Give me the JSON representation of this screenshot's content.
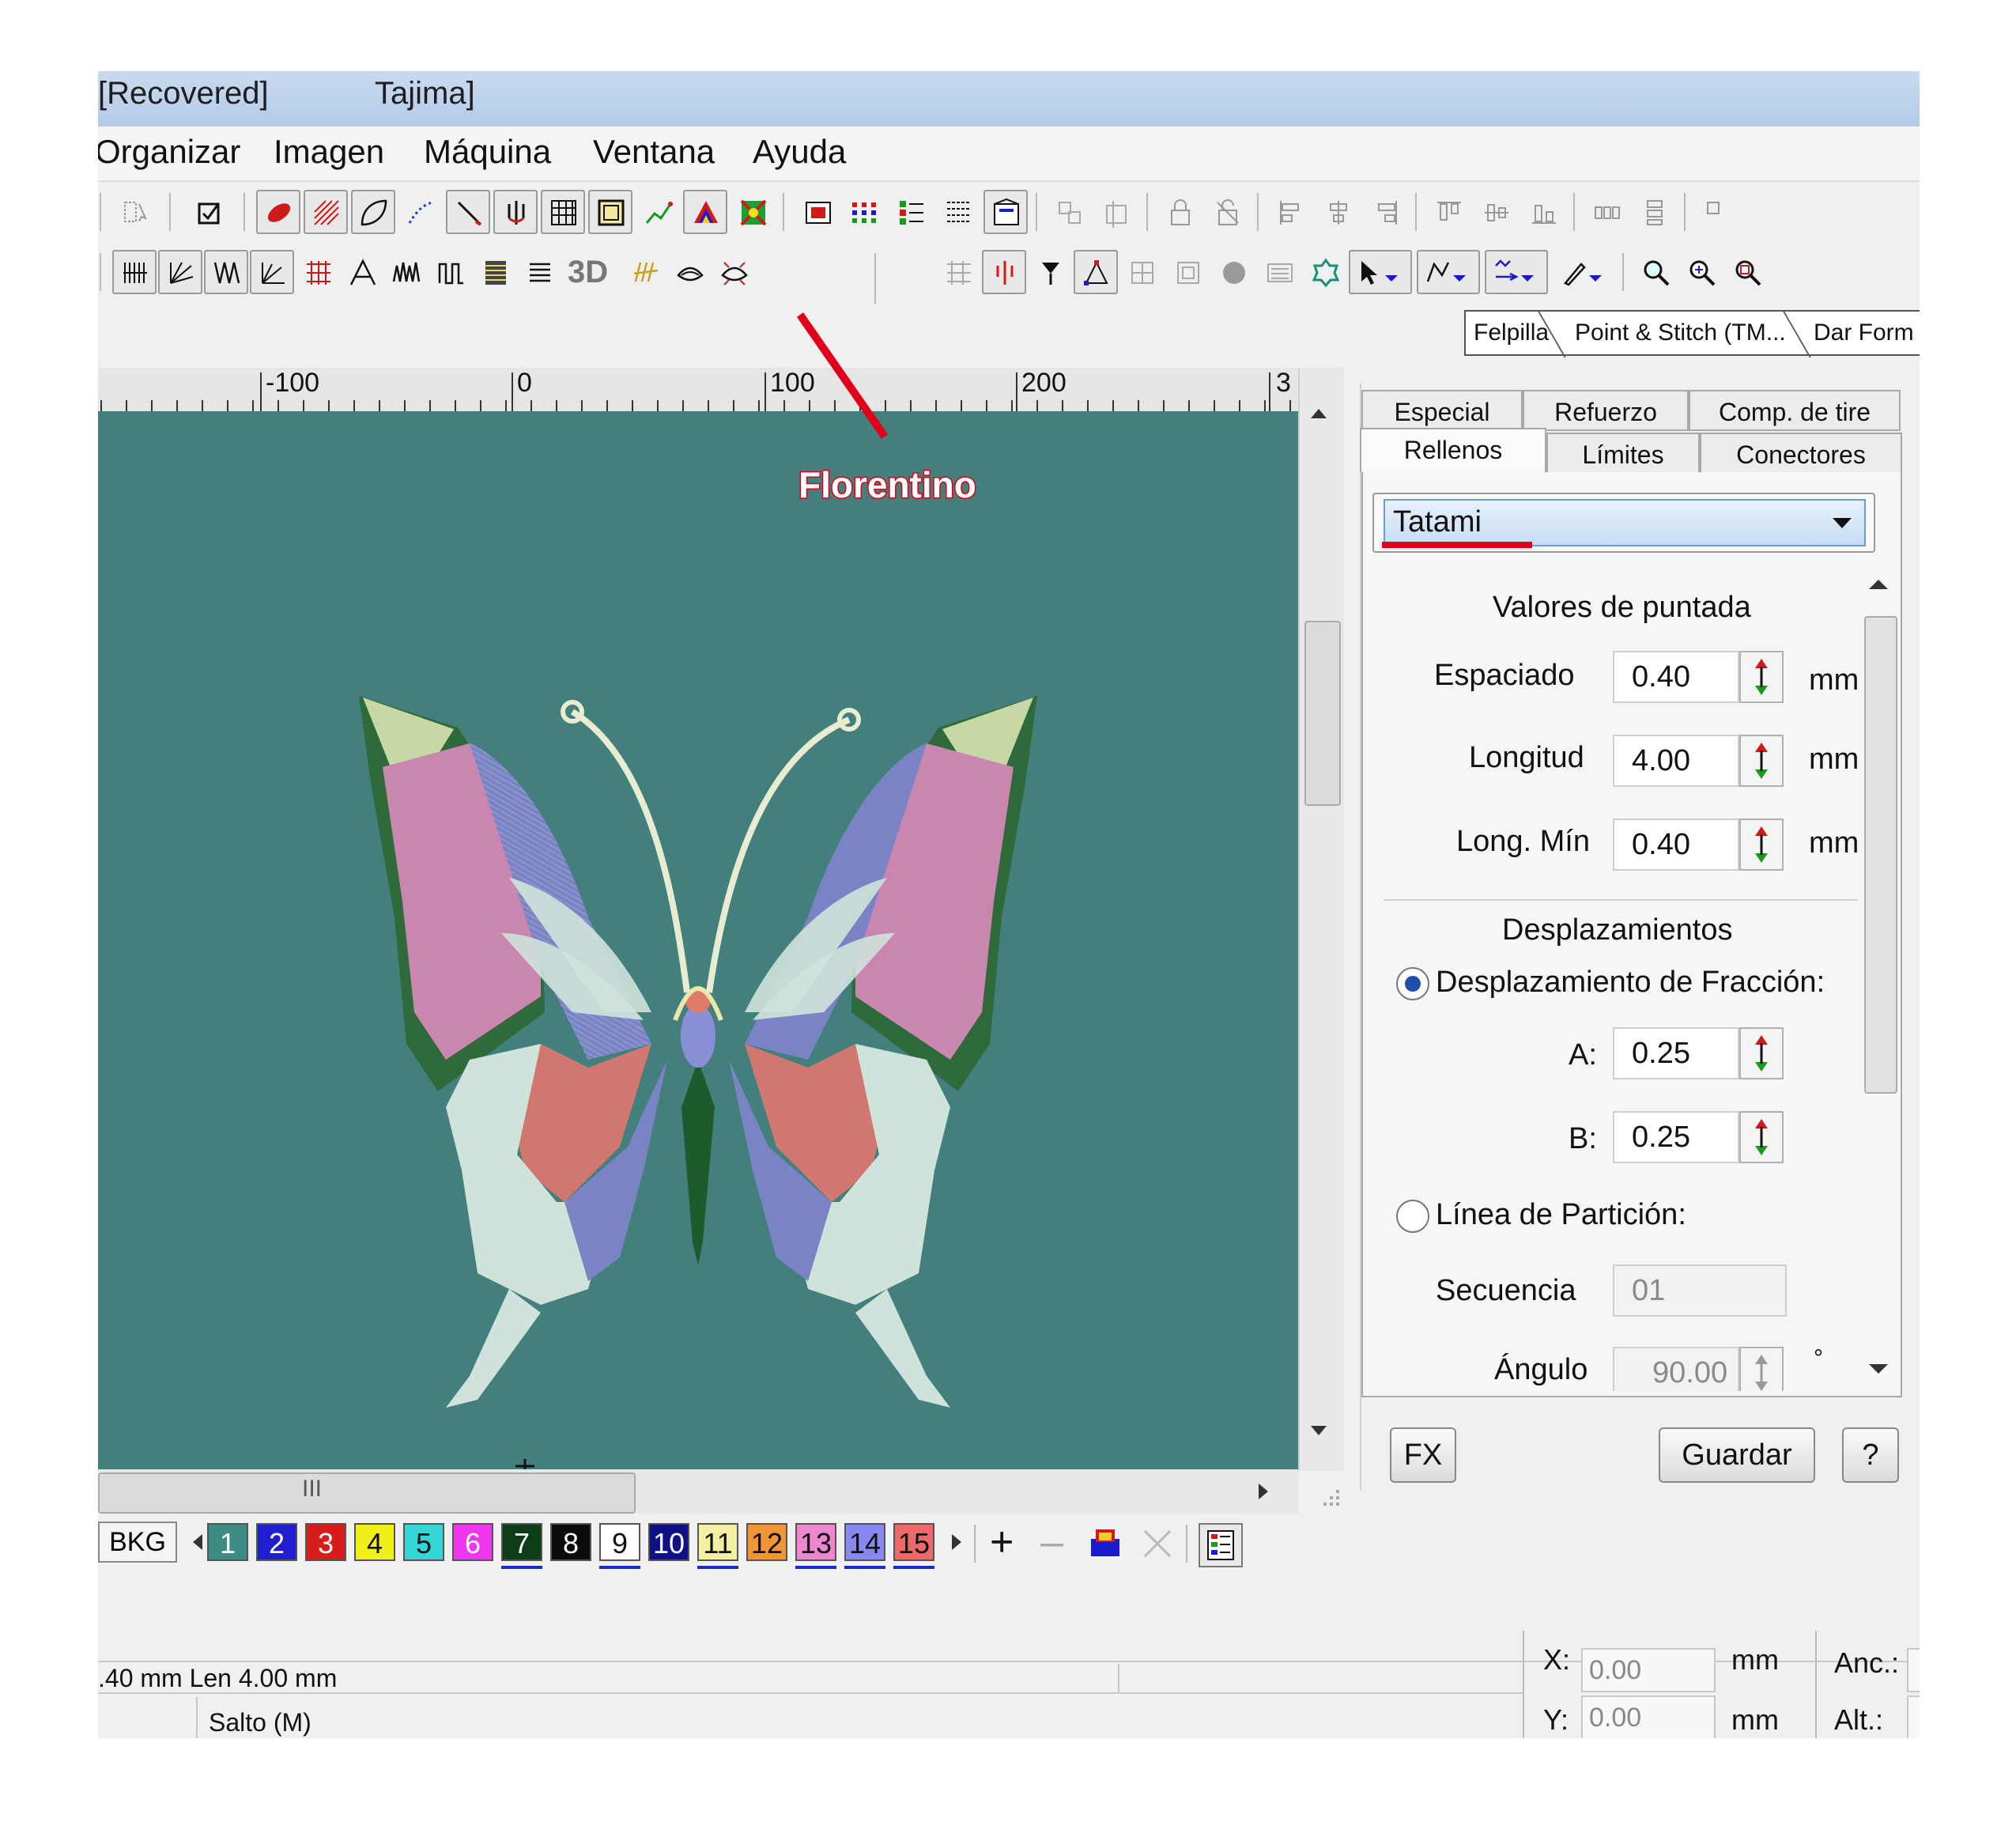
{
  "window": {
    "title_left": "[Recovered]",
    "title_right": "Tajima]"
  },
  "menu": [
    "Organizar",
    "Imagen",
    "Máquina",
    "Ventana",
    "Ayuda"
  ],
  "toolbar": {
    "label_3d": "3D"
  },
  "annotation": {
    "label": "Florentino",
    "color": "#e1001a"
  },
  "object_tabs": [
    "Felpilla",
    "Point & Stitch (TM...",
    "Dar Form"
  ],
  "ruler": {
    "labels": [
      "-100",
      "0",
      "100",
      "200",
      "3"
    ]
  },
  "hscroll": {
    "thumb_label": "III"
  },
  "colorbar": {
    "bkg_label": "BKG",
    "colors": [
      {
        "n": "1",
        "bg": "#3d8c85",
        "fg": "#ffffff",
        "underline": false
      },
      {
        "n": "2",
        "bg": "#1f1fcf",
        "fg": "#ffffff",
        "underline": false
      },
      {
        "n": "3",
        "bg": "#d81c1c",
        "fg": "#ffffff",
        "underline": false
      },
      {
        "n": "4",
        "bg": "#f1ef1a",
        "fg": "#111111",
        "underline": false
      },
      {
        "n": "5",
        "bg": "#35d6d6",
        "fg": "#111111",
        "underline": false
      },
      {
        "n": "6",
        "bg": "#ee36ee",
        "fg": "#ffffff",
        "underline": false
      },
      {
        "n": "7",
        "bg": "#0c3d16",
        "fg": "#ffffff",
        "underline": true
      },
      {
        "n": "8",
        "bg": "#0b0b0b",
        "fg": "#ffffff",
        "underline": false
      },
      {
        "n": "9",
        "bg": "#ffffff",
        "fg": "#111111",
        "underline": true
      },
      {
        "n": "10",
        "bg": "#101085",
        "fg": "#ffffff",
        "underline": false
      },
      {
        "n": "11",
        "bg": "#f3f0a4",
        "fg": "#111111",
        "underline": true
      },
      {
        "n": "12",
        "bg": "#f09637",
        "fg": "#111111",
        "underline": false
      },
      {
        "n": "13",
        "bg": "#ee86d0",
        "fg": "#111111",
        "underline": true
      },
      {
        "n": "14",
        "bg": "#8888ee",
        "fg": "#111111",
        "underline": true
      },
      {
        "n": "15",
        "bg": "#ec6a6a",
        "fg": "#111111",
        "underline": true
      }
    ]
  },
  "panel": {
    "tabs_row1": [
      "Especial",
      "Refuerzo",
      "Comp. de tire"
    ],
    "tabs_row2": [
      "Rellenos",
      "Límites",
      "Conectores"
    ],
    "fill_type": "Tatami",
    "section1": "Valores de puntada",
    "espaciado": {
      "label": "Espaciado",
      "value": "0.40",
      "unit": "mm"
    },
    "longitud": {
      "label": "Longitud",
      "value": "4.00",
      "unit": "mm"
    },
    "longmin": {
      "label": "Long. Mín",
      "value": "0.40",
      "unit": "mm"
    },
    "section2": "Desplazamientos",
    "radio1": "Desplazamiento de Fracción:",
    "a": {
      "label": "A:",
      "value": "0.25"
    },
    "b": {
      "label": "B:",
      "value": "0.25"
    },
    "radio2": "Línea de Partición:",
    "secuencia": {
      "label": "Secuencia",
      "value": "01"
    },
    "angulo": {
      "label": "Ángulo",
      "value": "90.00",
      "unit": "°"
    },
    "fx_label": "FX",
    "save_label": "Guardar",
    "help_label": "?"
  },
  "status": {
    "left_top": ".40 mm Len  4.00 mm",
    "left_bottom": "Salto (M)",
    "x_label": "X:",
    "x_value": "0.00",
    "x_unit": "mm",
    "y_label": "Y:",
    "y_value": "0.00",
    "y_unit": "mm",
    "anc_label": "Anc.:",
    "alt_label": "Alt.:"
  },
  "colors": {
    "canvas_bg": "#437f7c",
    "annotation_red": "#e1001a"
  }
}
